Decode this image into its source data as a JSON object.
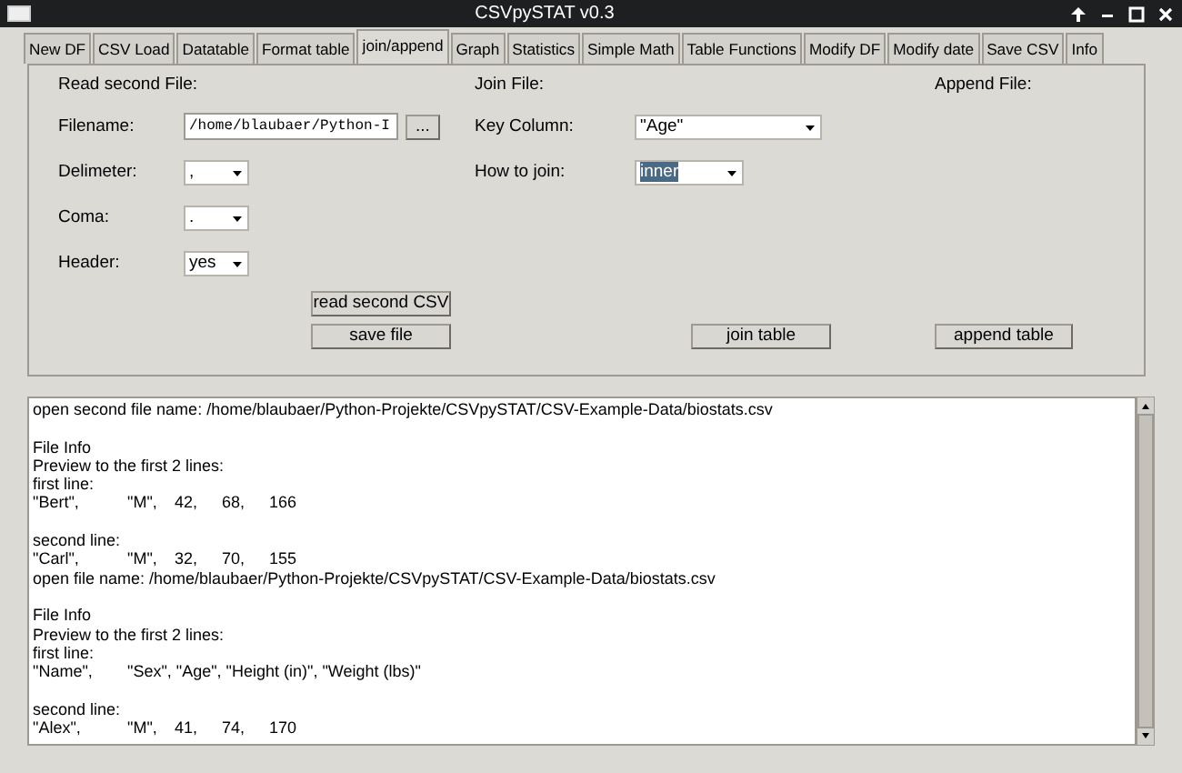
{
  "window": {
    "title": "CSVpySTAT v0.3"
  },
  "tabs": [
    {
      "label": "New DF",
      "selected": false
    },
    {
      "label": "CSV Load",
      "selected": false
    },
    {
      "label": "Datatable",
      "selected": false
    },
    {
      "label": "Format table",
      "selected": false
    },
    {
      "label": "join/append",
      "selected": true
    },
    {
      "label": "Graph",
      "selected": false
    },
    {
      "label": "Statistics",
      "selected": false
    },
    {
      "label": "Simple Math",
      "selected": false
    },
    {
      "label": "Table Functions",
      "selected": false
    },
    {
      "label": "Modify DF",
      "selected": false
    },
    {
      "label": "Modify date",
      "selected": false
    },
    {
      "label": "Save CSV",
      "selected": false
    },
    {
      "label": "Info",
      "selected": false
    }
  ],
  "read_section": {
    "heading": "Read second File:",
    "filename": {
      "label": "Filename:",
      "value": "/home/blaubaer/Python-I",
      "browse_button": "..."
    },
    "options": [
      {
        "label": "Delimeter:",
        "value": ","
      },
      {
        "label": "Coma:",
        "value": "."
      },
      {
        "label": "Header:",
        "value": "yes"
      }
    ],
    "read_button": "read second CSV",
    "save_button": "save file"
  },
  "join_section": {
    "heading": "Join File:",
    "fields": [
      {
        "label": "Key Column:",
        "value": "\"Age\"",
        "highlighted": false
      },
      {
        "label": "How to join:",
        "value": "inner",
        "highlighted": true
      }
    ],
    "join_button": "join table"
  },
  "append_section": {
    "heading": "Append File:",
    "append_button": "append table"
  },
  "log": [
    [
      "open second file name: /home/blaubaer/Python-Projekte/CSVpySTAT/CSV-Example-Data/biostats.csv"
    ],
    [
      "File Info",
      "Preview to the first 2 lines:",
      "first line:",
      "\"Bert\",\t\"M\",\t42,\t68,\t166"
    ],
    [
      "second line:",
      "\"Carl\",\t\"M\",\t32,\t70,\t155",
      "open file name: /home/blaubaer/Python-Projekte/CSVpySTAT/CSV-Example-Data/biostats.csv"
    ],
    [
      "File Info",
      "Preview to the first 2 lines:",
      "first line:",
      "\"Name\",\t\"Sex\", \"Age\", \"Height (in)\", \"Weight (lbs)\""
    ],
    [
      "second line:",
      "\"Alex\",\t\"M\",\t41,\t74,\t170"
    ]
  ]
}
